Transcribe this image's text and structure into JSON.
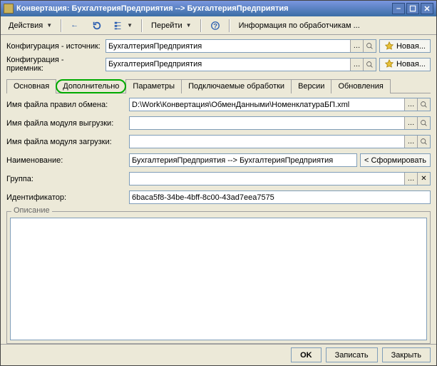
{
  "window": {
    "title": "Конвертация: БухгалтерияПредприятия --> БухгалтерияПредприятия"
  },
  "toolbar": {
    "actions": "Действия",
    "goto": "Перейти",
    "info": "Информация по обработчикам ..."
  },
  "config": {
    "source_label": "Конфигурация - источник:",
    "source_value": "БухгалтерияПредприятия",
    "target_label": "Конфигурация - приемник:",
    "target_value": "БухгалтерияПредприятия",
    "new_btn": "Новая..."
  },
  "tabs": {
    "main": "Основная",
    "additional": "Дополнительно",
    "params": "Параметры",
    "plugins": "Подключаемые обработки",
    "versions": "Версии",
    "updates": "Обновления"
  },
  "fields": {
    "rules_file_label": "Имя файла правил обмена:",
    "rules_file_value": "D:\\Work\\Конвертация\\ОбменДанными\\НоменклатураБП.xml",
    "export_module_label": "Имя файла модуля выгрузки:",
    "export_module_value": "",
    "import_module_label": "Имя файла модуля загрузки:",
    "import_module_value": "",
    "name_label": "Наименование:",
    "name_value": "БухгалтерияПредприятия --> БухгалтерияПредприятия",
    "form_btn": "< Сформировать",
    "group_label": "Группа:",
    "group_value": "",
    "id_label": "Идентификатор:",
    "id_value": "6baca5f8-34be-4bff-8c00-43ad7eea7575"
  },
  "description_legend": "Описание",
  "footer": {
    "ok": "OK",
    "save": "Записать",
    "close": "Закрыть"
  }
}
